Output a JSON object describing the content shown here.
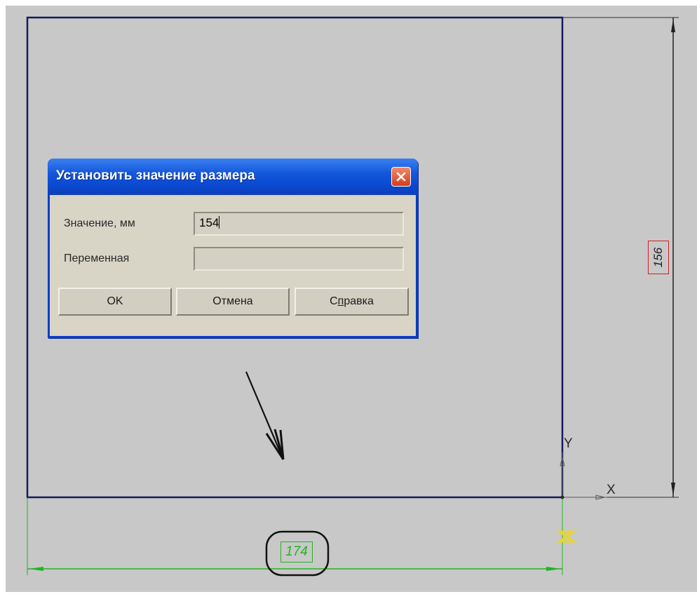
{
  "dialog": {
    "title": "Установить значение размера",
    "value_label": "Значение, мм",
    "value": "154",
    "variable_label": "Переменная",
    "variable_value": "",
    "ok_label": "OK",
    "cancel_label": "Отмена",
    "help_label_prefix": "С",
    "help_label_underlined": "п",
    "help_label_suffix": "равка"
  },
  "drawing": {
    "horizontal_dimension": "174",
    "vertical_dimension": "156",
    "axis_x_label": "X",
    "axis_y_label": "Y"
  },
  "colors": {
    "canvas": "#c8c8c8",
    "sketch_outline": "#141c5c",
    "dimension_horizontal": "#22b422",
    "dimension_vertical_frame": "#d02020",
    "dialog_title_bar": "#0a48d0",
    "dialog_body": "#d8d4c6",
    "close_button": "#d63a1a"
  }
}
